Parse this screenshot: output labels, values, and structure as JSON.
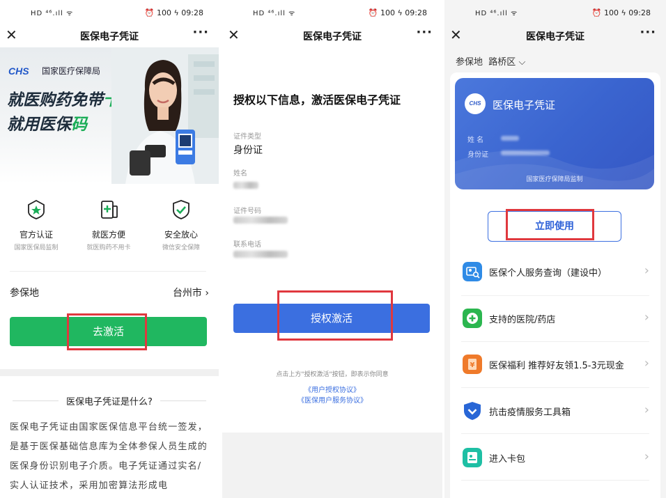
{
  "status": {
    "left": "HD ⁴⁶.ıll ᯤ",
    "right": "⏰ 100 ϟ 09:28"
  },
  "titlebar": {
    "title": "医保电子凭证",
    "close": "✕",
    "more": "···"
  },
  "panel1": {
    "logo": "CHS",
    "org": "国家医疗保障局",
    "slogan1_a": "就医购药免带",
    "slogan1_b": "卡",
    "slogan2_a": "就用医保",
    "slogan2_b": "码",
    "features": [
      {
        "name": "官方认证",
        "sub": "国家医保局监制",
        "icon": "star-badge-icon"
      },
      {
        "name": "就医方便",
        "sub": "就医购药不用卡",
        "icon": "plus-phone-icon"
      },
      {
        "name": "安全放心",
        "sub": "微信安全保障",
        "icon": "shield-check-icon"
      }
    ],
    "region_label": "参保地",
    "region_value": "台州市 ›",
    "activate_button": "去激活",
    "whatis": "医保电子凭证是什么?",
    "paragraph": "医保电子凭证由国家医保信息平台统一签发，是基于医保基础信息库为全体参保人员生成的医保身份识别电子介质。电子凭证通过实名/实人认证技术，采用加密算法形成电"
  },
  "panel2": {
    "title": "授权以下信息，激活医保电子凭证",
    "id_type_label": "证件类型",
    "id_type_value": "身份证",
    "name_label": "姓名",
    "id_no_label": "证件号码",
    "phone_label": "联系电话",
    "authorize_button": "授权激活",
    "consent": "点击上方\"授权激活\"按钮，即表示你同意",
    "link1": "《用户授权协议》",
    "link2": "《医保用户服务协议》"
  },
  "panel3": {
    "region_label": "参保地",
    "region_value": "路桥区",
    "card_title": "医保电子凭证",
    "card_seal": "CHS",
    "card_name_label": "姓  名",
    "card_id_label": "身份证",
    "card_supervise": "国家医疗保障局监制",
    "use_button": "立即使用",
    "menu": [
      {
        "label": "医保个人服务查询（建设中）",
        "icon": "id-search-icon",
        "color": "#2f8be6"
      },
      {
        "label": "支持的医院/药店",
        "icon": "medical-plus-icon",
        "color": "#2bb64f"
      },
      {
        "label": "医保福利 推荐好友领1.5-3元现金",
        "icon": "yen-envelope-icon",
        "color": "#ef7a2a"
      },
      {
        "label": "抗击疫情服务工具箱",
        "icon": "shield-chevron-icon",
        "color": "#2866d6"
      },
      {
        "label": "进入卡包",
        "icon": "card-wallet-icon",
        "color": "#1ebfa4"
      }
    ]
  },
  "colors": {
    "green": "#20b760",
    "blue": "#3b6fe0",
    "highlight": "#e0383e"
  }
}
